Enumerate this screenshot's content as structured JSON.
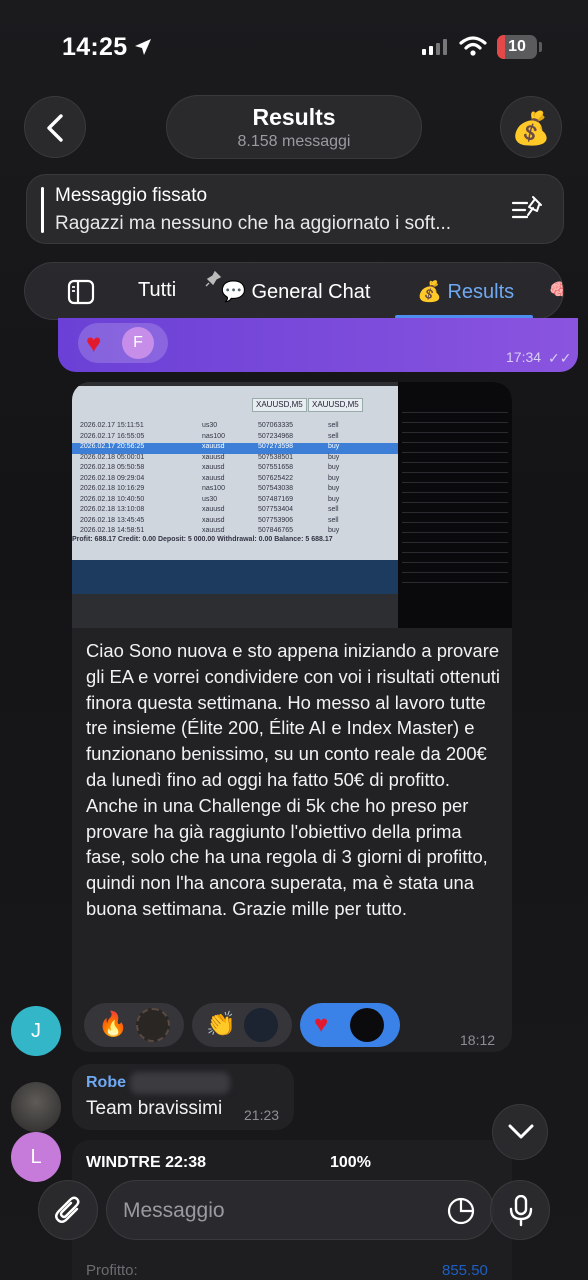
{
  "status_bar": {
    "time": "14:25",
    "battery": "10"
  },
  "header": {
    "title": "Results",
    "subtitle": "8.158 messaggi",
    "avatar_emoji": "💰"
  },
  "pinned": {
    "title": "Messaggio fissato",
    "text": "Ragazzi ma nessuno che ha aggiornato i soft..."
  },
  "tabs": {
    "all": "Tutti",
    "general": "💬 General Chat",
    "results": "💰 Results"
  },
  "prev_message": {
    "reaction_heart": "♥",
    "reaction_avatar": "F",
    "time": "17:34"
  },
  "photo": {
    "window_tabs": [
      "XAUUSD,M5",
      "XAUUSD,M5"
    ],
    "rows": [
      [
        "2026.02.17 15:11:51",
        "us30",
        "507063335",
        "sell"
      ],
      [
        "2026.02.17 16:55:05",
        "nas100",
        "507234968",
        "sell"
      ],
      [
        "2026.02.17 20:56:25",
        "xauusd",
        "507273598",
        "buy"
      ],
      [
        "2026.02.18 05:00:01",
        "xauusd",
        "507538501",
        "buy"
      ],
      [
        "2026.02.18 05:50:58",
        "xauusd",
        "507551658",
        "buy"
      ],
      [
        "2026.02.18 09:29:04",
        "xauusd",
        "507625422",
        "buy"
      ],
      [
        "2026.02.18 10:16:29",
        "nas100",
        "507543038",
        "buy"
      ],
      [
        "2026.02.18 10:40:50",
        "us30",
        "507487169",
        "buy"
      ],
      [
        "2026.02.18 13:10:08",
        "xauusd",
        "507753404",
        "sell"
      ],
      [
        "2026.02.18 13:45:45",
        "xauusd",
        "507753906",
        "sell"
      ],
      [
        "2026.02.18 14:58:51",
        "xauusd",
        "507846765",
        "buy"
      ]
    ],
    "summary": "Profit: 688.17  Credit: 0.00  Deposit: 5 000.00  Withdrawal: 0.00  Balance: 5 688.17"
  },
  "message": {
    "caption": "Ciao Sono nuova e sto appena iniziando a provare gli EA e vorrei condividere con voi i risultati ottenuti finora questa settimana. Ho messo al lavoro tutte tre insieme  (Élite 200, Élite AI e Index Master)  e funzionano benissimo, su un conto reale da 200€ da lunedì fino ad oggi ha fatto 50€ di profitto. Anche in una Challenge di 5k che ho preso per provare ha già raggiunto l'obiettivo della prima fase, solo che ha una regola di 3 giorni di profitto, quindi non l'ha ancora superata, ma è stata una buona settimana. Grazie mille per tutto.",
    "time": "18:12",
    "reactions": [
      "🔥",
      "👏",
      "♥"
    ],
    "avatar": "J"
  },
  "reply": {
    "sender": "Robe",
    "text": "Team bravissimi",
    "time": "21:23"
  },
  "avatars": {
    "second": "L"
  },
  "shot": {
    "status_left": "WINDTRE 22:38",
    "status_right": "100%",
    "profit_label": "Profitto:",
    "profit_value": "855.50"
  },
  "composer": {
    "placeholder": "Messaggio"
  },
  "colors": {
    "accent": "#4e8ef0",
    "purple": "#7a4adc",
    "bubble": "#222225"
  }
}
